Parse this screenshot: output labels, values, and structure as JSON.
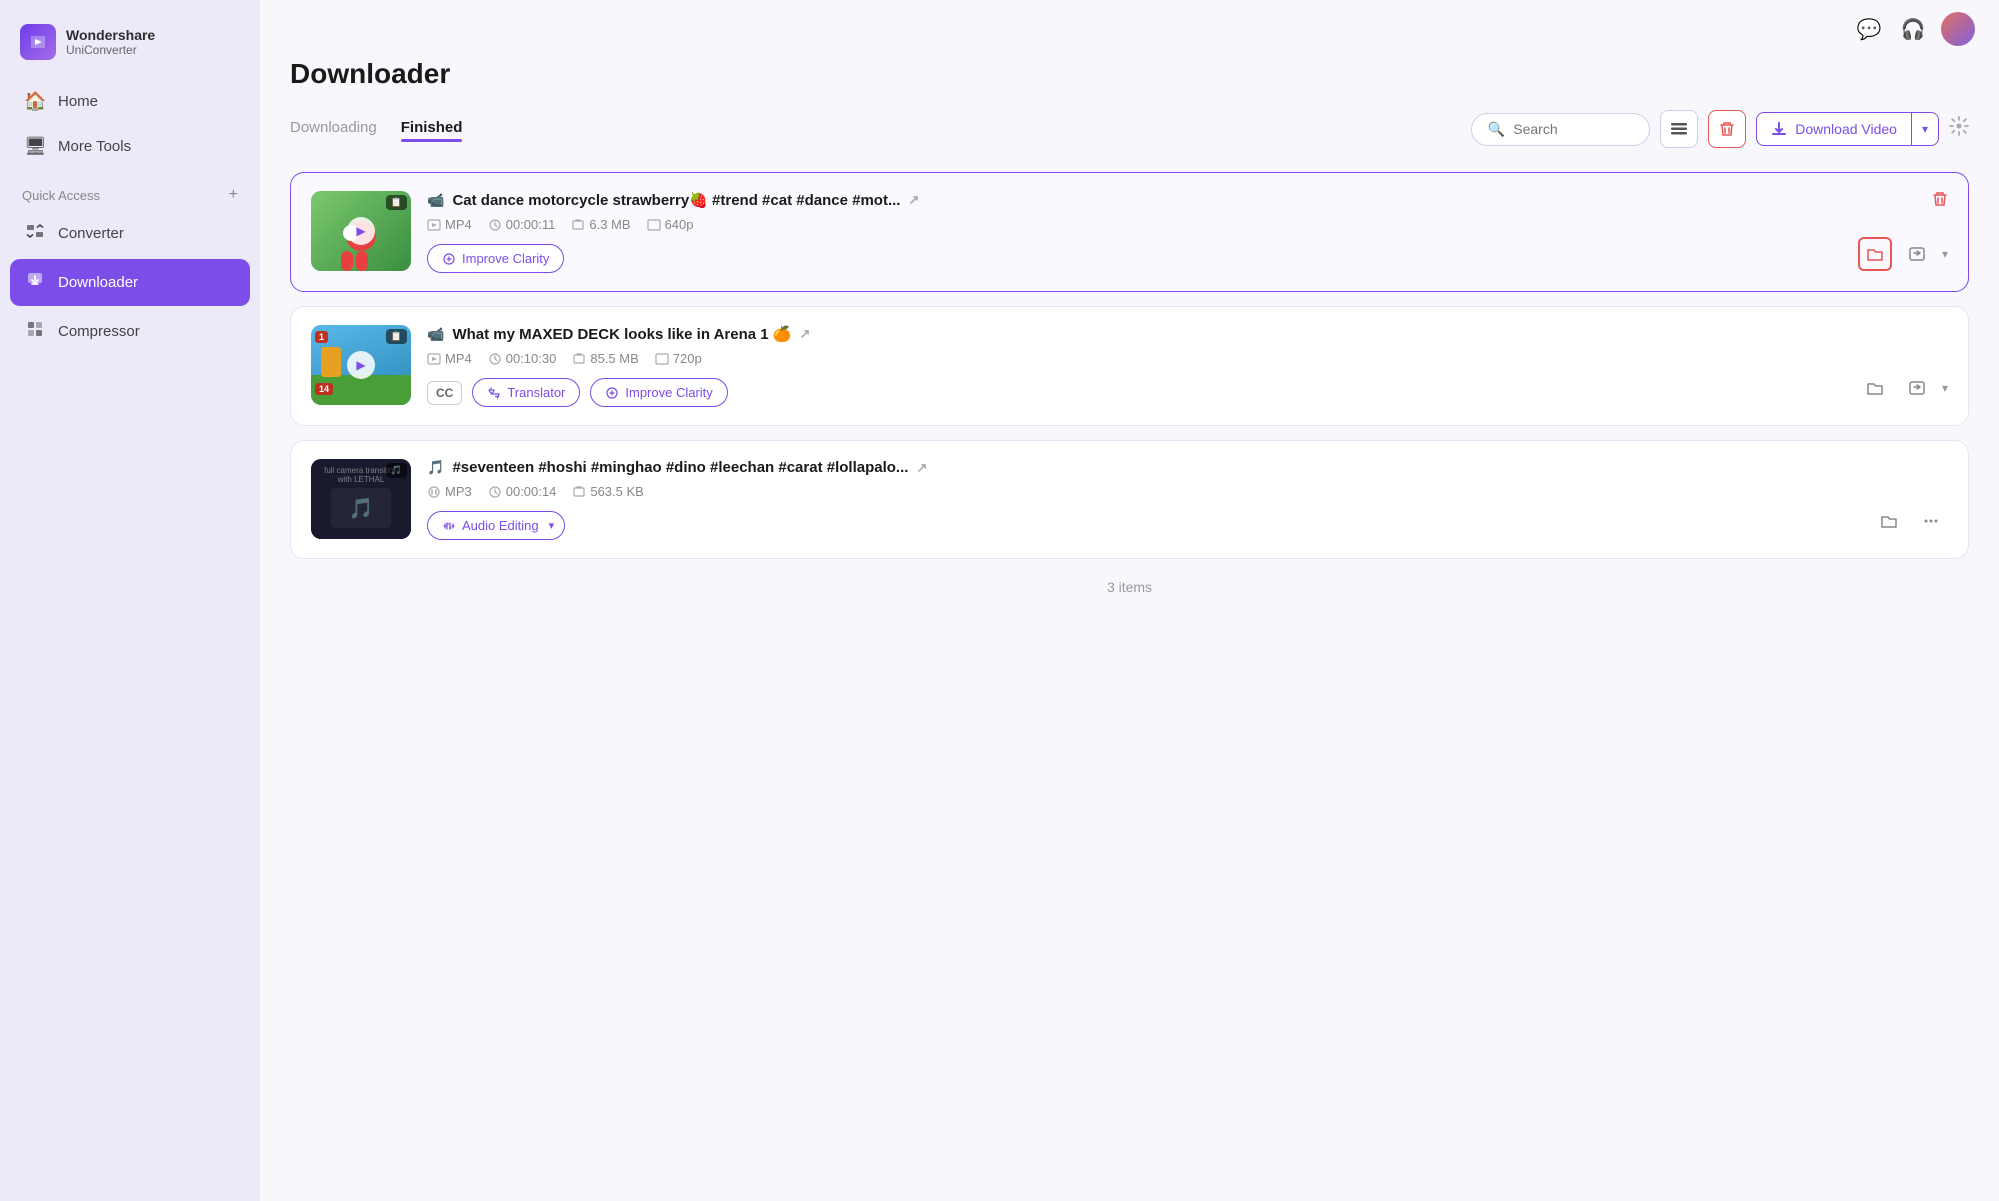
{
  "app": {
    "name": "Wondershare",
    "product": "UniConverter"
  },
  "sidebar": {
    "nav_items": [
      {
        "id": "home",
        "label": "Home",
        "icon": "🏠",
        "active": false
      },
      {
        "id": "more-tools",
        "label": "More Tools",
        "icon": "🖥",
        "active": false
      }
    ],
    "quick_access_label": "Quick Access",
    "quick_access_items": [
      {
        "id": "converter",
        "label": "Converter",
        "icon": "🔄",
        "active": false
      },
      {
        "id": "downloader",
        "label": "Downloader",
        "icon": "📥",
        "active": true
      },
      {
        "id": "compressor",
        "label": "Compressor",
        "icon": "🗜",
        "active": false
      }
    ]
  },
  "page": {
    "title": "Downloader",
    "tab_downloading": "Downloading",
    "tab_finished": "Finished",
    "items_count": "3 items"
  },
  "toolbar": {
    "search_placeholder": "Search",
    "list_view_icon": "list-icon",
    "delete_icon": "delete-icon",
    "download_video_label": "Download Video",
    "settings_icon": "settings-icon"
  },
  "items": [
    {
      "id": "item1",
      "title": "Cat dance motorcycle strawberry🍓 #trend #cat #dance #mot...",
      "type": "video",
      "type_icon": "📹",
      "format": "MP4",
      "duration": "00:00:11",
      "size": "6.3 MB",
      "resolution": "640p",
      "selected": true,
      "actions": [
        "Improve Clarity"
      ],
      "thumb_type": "cat"
    },
    {
      "id": "item2",
      "title": "What my MAXED DECK looks like in Arena 1 🍊",
      "type": "video",
      "type_icon": "📹",
      "format": "MP4",
      "duration": "00:10:30",
      "size": "85.5 MB",
      "resolution": "720p",
      "selected": false,
      "actions": [
        "CC",
        "Translator",
        "Improve Clarity"
      ],
      "thumb_type": "clash"
    },
    {
      "id": "item3",
      "title": "#seventeen #hoshi #minghao #dino #leechan #carat #lollapalo...",
      "type": "audio",
      "type_icon": "🎵",
      "format": "MP3",
      "duration": "00:00:14",
      "size": "563.5 KB",
      "resolution": null,
      "selected": false,
      "actions": [
        "Audio Editing"
      ],
      "thumb_type": "music"
    }
  ]
}
